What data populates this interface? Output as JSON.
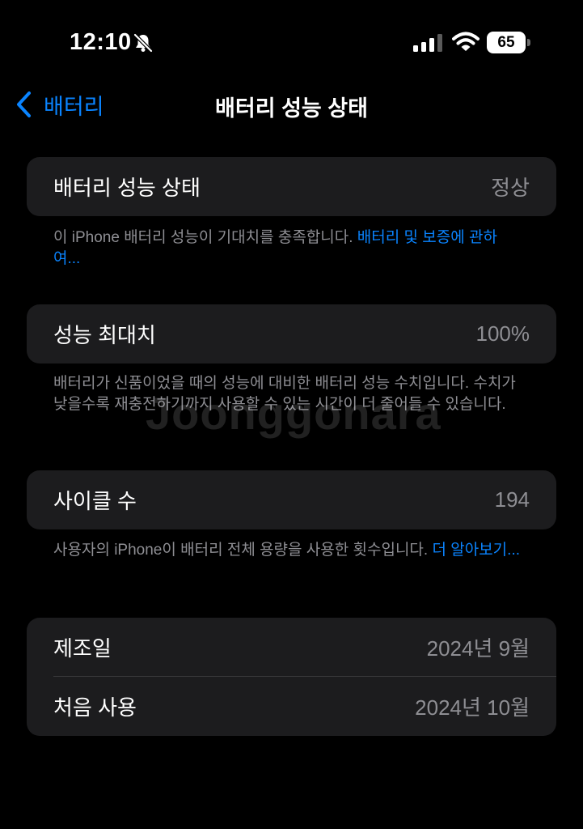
{
  "status_bar": {
    "time": "12:10",
    "battery_level": "65",
    "icons": [
      "bell-slash-icon",
      "cellular-signal-icon",
      "wifi-icon",
      "battery-icon"
    ]
  },
  "nav": {
    "back_label": "배터리",
    "title": "배터리 성능 상태"
  },
  "health_card": {
    "label": "배터리 성능 상태",
    "value": "정상"
  },
  "health_note": {
    "text": "이 iPhone 배터리 성능이 기대치를 충족합니다. ",
    "link": "배터리 및 보증에 관하여..."
  },
  "capacity_card": {
    "label": "성능 최대치",
    "value": "100%"
  },
  "capacity_note": {
    "text": "배터리가 신품이었을 때의 성능에 대비한 배터리 성능 수치입니다. 수치가 낮을수록 재충전하기까지 사용할 수 있는 시간이 더 줄어들 수 있습니다."
  },
  "cycle_card": {
    "label": "사이클 수",
    "value": "194"
  },
  "cycle_note": {
    "text": "사용자의 iPhone이 배터리 전체 용량을 사용한 횟수입니다. ",
    "link": "더 알아보기..."
  },
  "dates_card": {
    "manufacture_label": "제조일",
    "manufacture_value": "2024년 9월",
    "first_use_label": "처음 사용",
    "first_use_value": "2024년 10월"
  },
  "watermark": "Joonggonara",
  "colors": {
    "background": "#000000",
    "card": "#1c1c1e",
    "accent": "#0a84ff",
    "secondary_text": "#8e8e93"
  }
}
